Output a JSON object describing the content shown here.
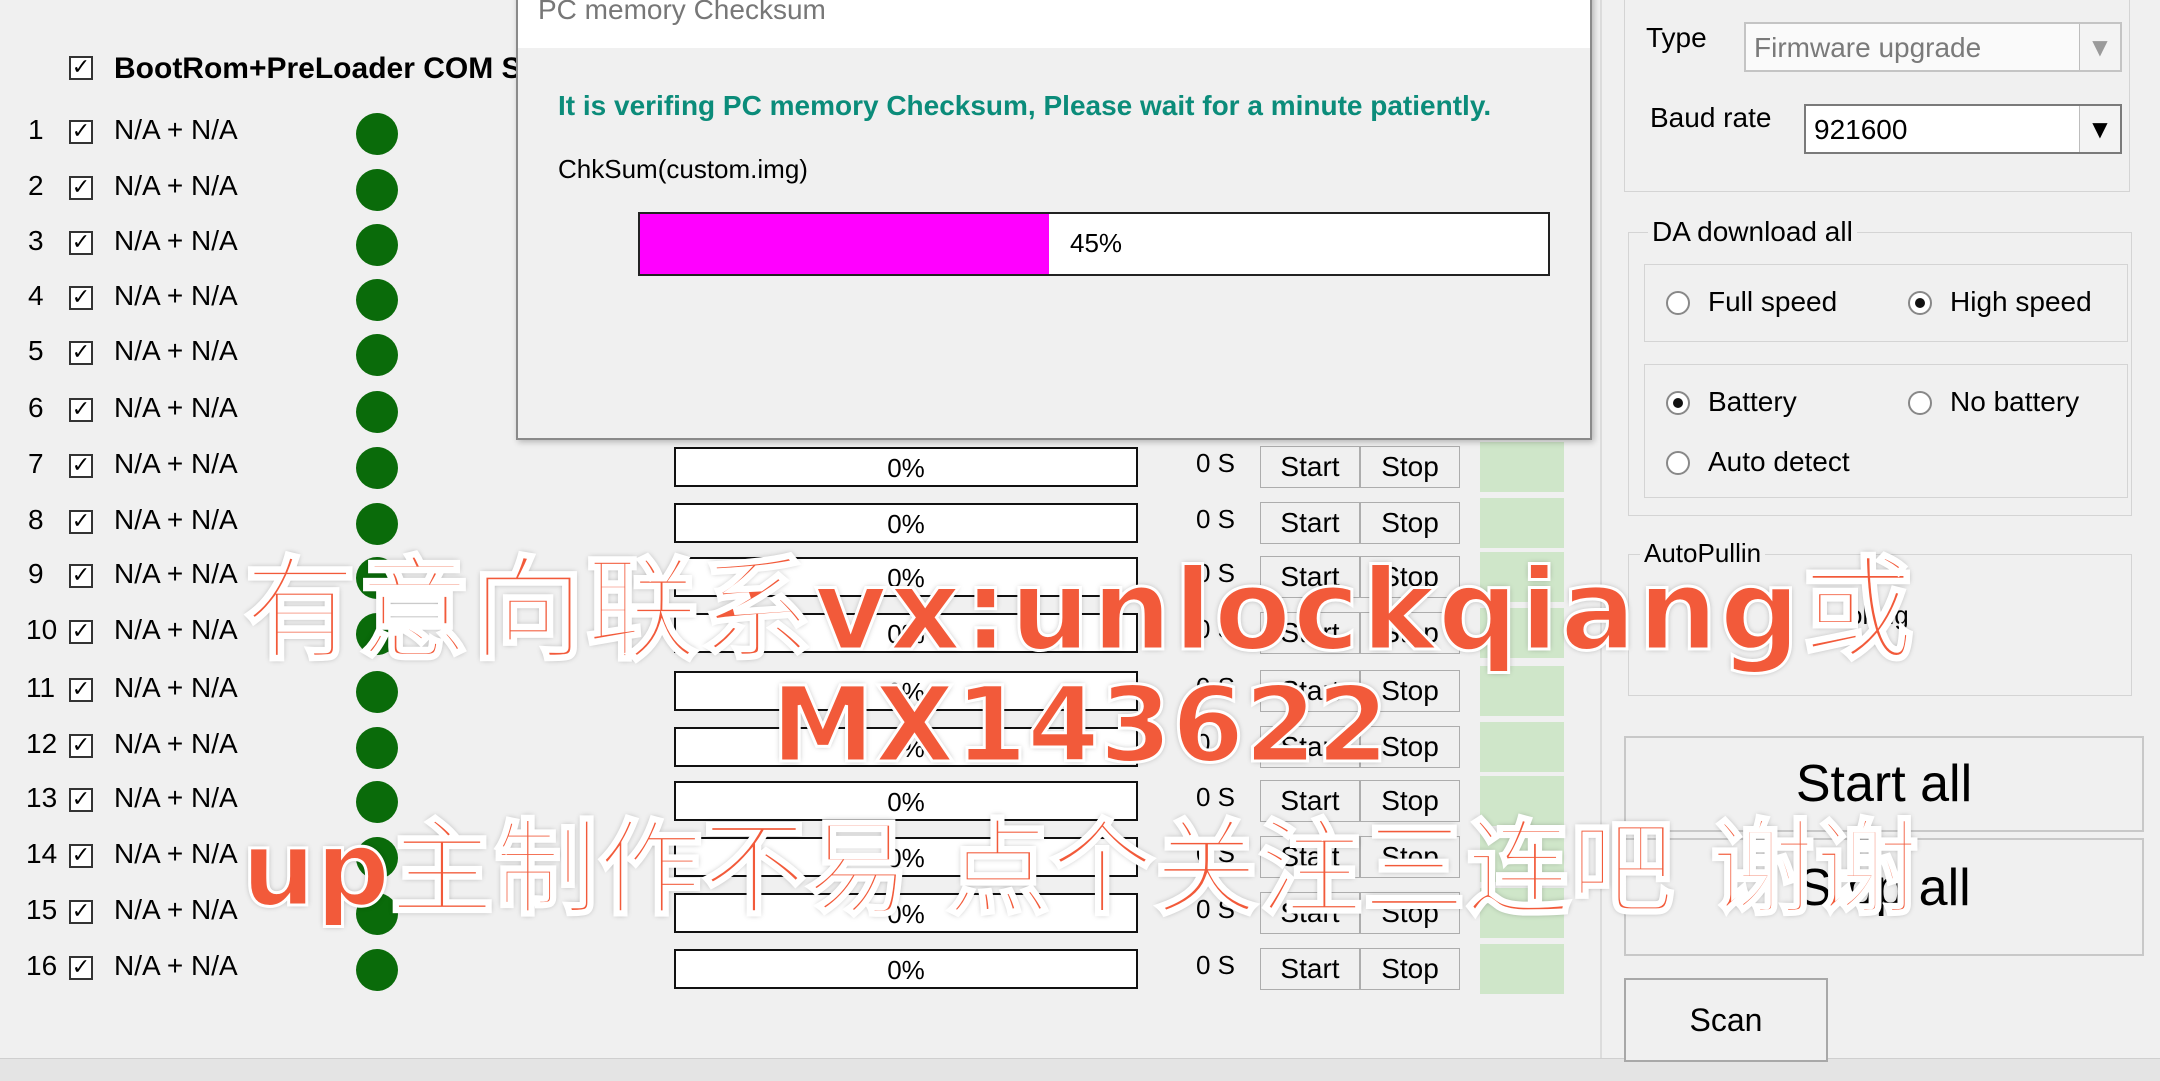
{
  "header": {
    "checked": true,
    "label": "BootRom+PreLoader COM S"
  },
  "ports": [
    {
      "num": "1",
      "name": "N/A + N/A"
    },
    {
      "num": "2",
      "name": "N/A + N/A"
    },
    {
      "num": "3",
      "name": "N/A + N/A"
    },
    {
      "num": "4",
      "name": "N/A + N/A"
    },
    {
      "num": "5",
      "name": "N/A + N/A"
    },
    {
      "num": "6",
      "name": "N/A + N/A"
    },
    {
      "num": "7",
      "name": "N/A + N/A",
      "progress": "0%",
      "time": "0 S",
      "start": "Start",
      "stop": "Stop"
    },
    {
      "num": "8",
      "name": "N/A + N/A",
      "progress": "0%",
      "time": "0 S",
      "start": "Start",
      "stop": "Stop"
    },
    {
      "num": "9",
      "name": "N/A + N/A",
      "progress": "0%",
      "time": "0 S",
      "start": "Start",
      "stop": "Stop"
    },
    {
      "num": "10",
      "name": "N/A + N/A",
      "progress": "0%",
      "time": "0 S",
      "start": "Start",
      "stop": "Stop"
    },
    {
      "num": "11",
      "name": "N/A + N/A",
      "progress": "0%",
      "time": "0 S",
      "start": "Start",
      "stop": "Stop"
    },
    {
      "num": "12",
      "name": "N/A + N/A",
      "progress": "0%",
      "time": "0 S",
      "start": "Start",
      "stop": "Stop"
    },
    {
      "num": "13",
      "name": "N/A + N/A",
      "progress": "0%",
      "time": "0 S",
      "start": "Start",
      "stop": "Stop"
    },
    {
      "num": "14",
      "name": "N/A + N/A",
      "progress": "0%",
      "time": "0 S",
      "start": "Start",
      "stop": "Stop"
    },
    {
      "num": "15",
      "name": "N/A + N/A",
      "progress": "0%",
      "time": "0 S",
      "start": "Start",
      "stop": "Stop"
    },
    {
      "num": "16",
      "name": "N/A + N/A",
      "progress": "0%",
      "time": "0 S",
      "start": "Start",
      "stop": "Stop"
    }
  ],
  "status_color": "#0a6b0a",
  "settings": {
    "type_label": "Type",
    "type_value": "Firmware upgrade",
    "baud_label": "Baud rate",
    "baud_value": "921600",
    "da_group_label": "DA download all",
    "full_speed": "Full speed",
    "high_speed": "High speed",
    "speed_selected": "high",
    "battery": "Battery",
    "no_battery": "No battery",
    "auto_detect": "Auto detect",
    "battery_selected": "battery",
    "autopulling_label": "AutoPullin",
    "autopulling_option": "olling"
  },
  "actions": {
    "start_all": "Start all",
    "stop_all": "Stop all",
    "scan": "Scan"
  },
  "dialog": {
    "title": "PC memory Checksum",
    "message": "It is verifing PC memory Checksum, Please wait for a minute  patiently.",
    "file": "ChkSum(custom.img)",
    "progress_label": "45%",
    "progress_value": 0.45,
    "bar_color": "#ff00ff"
  },
  "watermark": {
    "line1": "有意向联系vx:unlockqiang或",
    "line2": "MX143622",
    "line3": "up主制作不易 点个关注三连吧 谢谢",
    "color": "#f25a3a"
  }
}
